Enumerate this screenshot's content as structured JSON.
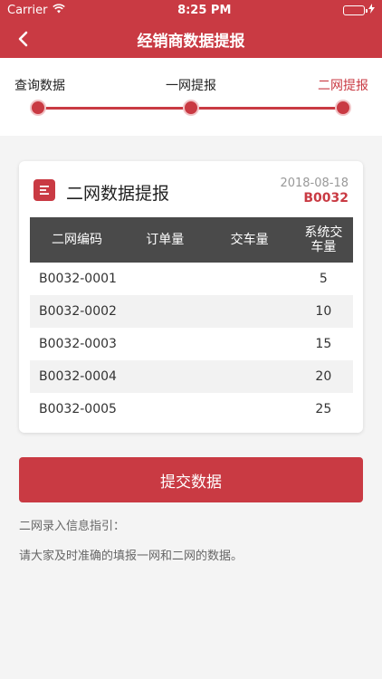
{
  "status_bar": {
    "carrier": "Carrier",
    "time": "8:25 PM"
  },
  "nav": {
    "title": "经销商数据提报"
  },
  "steps": [
    {
      "label": "查询数据",
      "active": false
    },
    {
      "label": "一网提报",
      "active": false
    },
    {
      "label": "二网提报",
      "active": true
    }
  ],
  "card": {
    "icon": "list-icon",
    "title": "二网数据提报",
    "date": "2018-08-18",
    "code": "B0032",
    "columns": [
      "二网编码",
      "订单量",
      "交车量",
      "系统交车量"
    ],
    "rows": [
      [
        "B0032-0001",
        "",
        "",
        "5"
      ],
      [
        "B0032-0002",
        "",
        "",
        "10"
      ],
      [
        "B0032-0003",
        "",
        "",
        "15"
      ],
      [
        "B0032-0004",
        "",
        "",
        "20"
      ],
      [
        "B0032-0005",
        "",
        "",
        "25"
      ]
    ]
  },
  "submit_label": "提交数据",
  "guide": {
    "title": "二网录入信息指引：",
    "text": "请大家及时准确的填报一网和二网的数据。"
  },
  "colors": {
    "primary": "#c93a43",
    "table_header": "#4a4a4a",
    "battery": "#3bd35e"
  }
}
